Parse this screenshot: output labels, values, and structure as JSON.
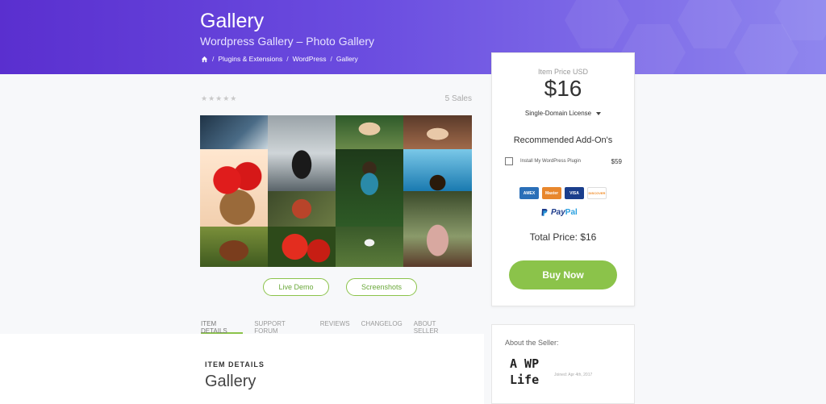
{
  "hero": {
    "title": "Gallery",
    "subtitle": "Wordpress Gallery – Photo Gallery",
    "breadcrumbs": [
      "Plugins & Extensions",
      "WordPress",
      "Gallery"
    ]
  },
  "product": {
    "stars": "★★★★★",
    "sales": "5 Sales",
    "buttons": {
      "demo": "Live Demo",
      "screenshots": "Screenshots"
    },
    "tabs": [
      "ITEM DETAILS",
      "SUPPORT FORUM",
      "REVIEWS",
      "CHANGELOG",
      "ABOUT SELLER"
    ],
    "active_tab": "ITEM DETAILS",
    "section_heading": "ITEM DETAILS",
    "section_title": "Gallery"
  },
  "price_card": {
    "label": "Item Price USD",
    "price": "$16",
    "license": "Single-Domain License",
    "addons_heading": "Recommended Add-On's",
    "addon": {
      "name": "Install My WordPress Plugin",
      "price": "$59"
    },
    "payments": [
      {
        "name": "amex-icon",
        "label": "AMEX",
        "color": "#2a6fb8"
      },
      {
        "name": "mastercard-icon",
        "label": "Master",
        "color": "#e8872d"
      },
      {
        "name": "visa-icon",
        "label": "VISA",
        "color": "#1a3e8c"
      },
      {
        "name": "discover-icon",
        "label": "DISCOVER",
        "color": "#f08a24"
      }
    ],
    "paypal_left": "Pay",
    "paypal_right": "Pal",
    "total": "Total Price: $16",
    "buy": "Buy Now"
  },
  "seller": {
    "heading": "About the Seller:",
    "logo_line1": "A WP",
    "logo_line2": "Life",
    "joined": "Joined: Apr 4th, 2017"
  },
  "colors": {
    "accent": "#8bc34a",
    "hero_start": "#5a2fcf",
    "hero_end": "#8f86ee"
  }
}
